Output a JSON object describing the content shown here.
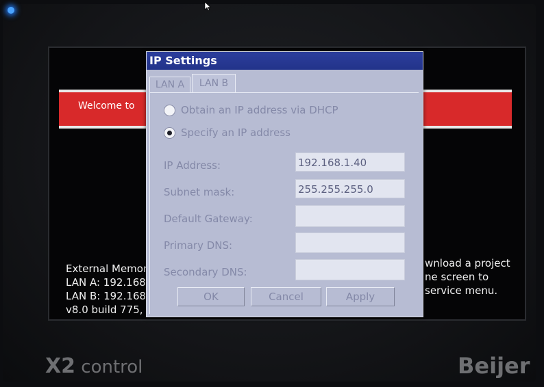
{
  "welcome_text": "Welcome to",
  "background": {
    "left_lines": [
      "External Memor",
      "LAN A: 192.168",
      "LAN B: 192.168",
      "v8.0 build 775,"
    ],
    "right_lines": [
      "wnload a project",
      "ne screen to",
      "service menu."
    ]
  },
  "brand": {
    "model_bold": "X2",
    "model_rest": " control",
    "maker": "Beijer"
  },
  "dialog": {
    "title": "IP Settings",
    "tabs": [
      {
        "label": "LAN A",
        "selected": false
      },
      {
        "label": "LAN B",
        "selected": true
      }
    ],
    "radios": [
      {
        "label": "Obtain an IP address via DHCP",
        "checked": false
      },
      {
        "label": "Specify an IP address",
        "checked": true
      }
    ],
    "fields": {
      "ip_address": {
        "label": "IP Address:",
        "value": "192.168.1.40"
      },
      "subnet_mask": {
        "label": "Subnet mask:",
        "value": "255.255.255.0"
      },
      "default_gateway": {
        "label": "Default Gateway:",
        "value": ""
      },
      "primary_dns": {
        "label": "Primary DNS:",
        "value": ""
      },
      "secondary_dns": {
        "label": "Secondary DNS:",
        "value": ""
      }
    },
    "buttons": {
      "ok": "OK",
      "cancel": "Cancel",
      "apply": "Apply"
    }
  },
  "colors": {
    "banner_red": "#d8292a",
    "dialog_bg": "#b7bcd3",
    "titlebar": "#2c3e9c",
    "led": "#4aa3ff"
  }
}
